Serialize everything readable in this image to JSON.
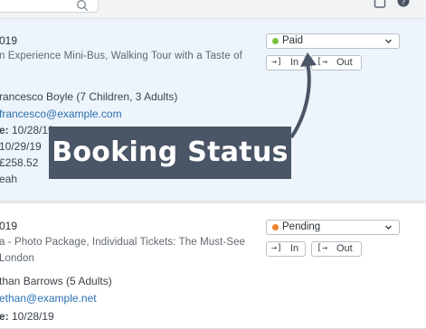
{
  "card1": {
    "date": "019",
    "tour": "n Experience Mini-Bus, Walking Tour with a Taste of",
    "customer": "rancesco Boyle (7 Children, 3 Adults)",
    "email": "francesco@example.com",
    "line1_label": "e:",
    "line1_value": " 10/28/19",
    "line2": " 10/29/19",
    "price": "£258.52",
    "note": "eah",
    "status": "Paid",
    "status_color": "#7ac142",
    "in_label": "In",
    "out_label": "Out"
  },
  "card2": {
    "date": "019",
    "tour": "a - Photo Package, Individual Tickets: The Must-See",
    "location": "London",
    "customer": "than Barrows (5 Adults)",
    "email": "ethan@example.net",
    "line1_label": "e:",
    "line1_value": " 10/28/19",
    "status": "Pending",
    "status_color": "#f0822a",
    "in_label": "In",
    "out_label": "Out"
  },
  "callout": {
    "label": "Booking Status",
    "color": "#4a5566"
  }
}
